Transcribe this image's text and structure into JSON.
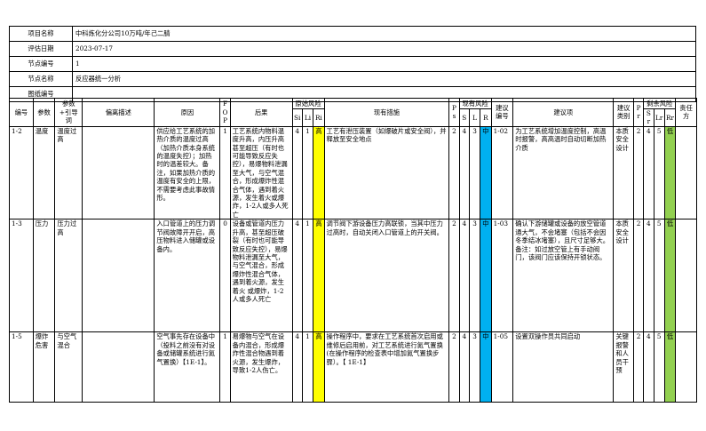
{
  "info": [
    {
      "label": "项目名称",
      "value": "中科炼化分公司10万吨/年己二腈"
    },
    {
      "label": "评估日期",
      "value": "2023-07-17"
    },
    {
      "label": "节点编号",
      "value": "1"
    },
    {
      "label": "节点名称",
      "value": "反应器统一分析"
    },
    {
      "label": "图纸编号",
      "value": ""
    }
  ],
  "headers": {
    "no": "编号",
    "param": "参数",
    "guideword": "参数+引导词",
    "deviation": "偏离描述",
    "cause": "原因",
    "fop": "FOP",
    "consequence": "后果",
    "orig_risk": "原始风险",
    "measures": "现有措施",
    "ps": "Ps",
    "cur_risk": "现有风险",
    "rec_no": "建议编号",
    "rec": "建议项",
    "rec_type": "建议类别",
    "pr": "Pr",
    "res_risk": "剩余风险",
    "owner": "责任方",
    "sub": {
      "si": "Si",
      "li": "Li",
      "ri": "Ri",
      "s": "S",
      "l": "L",
      "r": "R",
      "sr": "Sr",
      "lr": "Lr",
      "rr": "Rr"
    }
  },
  "rows": [
    {
      "no": "1-2",
      "param": "温度",
      "guideword": "温度过高",
      "deviation": "",
      "cause": "供应给工艺系统的加热介质的温度过高（加热介质本身系统的温度失控）；加热时的温差较大。备注，如果加热介质的温度有安全的上限，不需要考虑此事故情形。",
      "fop": "1",
      "consequence": "工艺系统内物料温度升高，内压升高甚至超压（有时也可能导致反应失控），易爆物料泄漏至大气，与空气混合，形成爆炸性混合气体，遇到着火源，发生着火或爆炸，1-2人或多人死亡",
      "si": "4",
      "li": "1",
      "ri": "高",
      "measures": "工艺有泄压装置（如爆破片或安全阀），并释放至安全地点",
      "ps": "2",
      "s": "4",
      "l": "3",
      "r": "中",
      "rec_no": "1-02",
      "rec": "为工艺系统增加温度控制，高温时报警，高高温时自动切断加热介质",
      "rec_type": "本质安全设计",
      "pr": "2",
      "sr": "4",
      "lr": "5",
      "rr": "低",
      "owner": ""
    },
    {
      "no": "1-3",
      "param": "压力",
      "guideword": "压力过高",
      "deviation": "",
      "cause": "入口管道上的压力调节阀故障开开启，高压物料进入储罐或设备内。",
      "fop": "0",
      "consequence": "设备或管道内压力升高，甚至超压破裂（有时也可能导致反应失控），易爆物料泄漏至大气，与空气混合，形成爆炸性混合气体，遇到着火源，发生着火 或爆炸，1-2人或多人死亡",
      "si": "4",
      "li": "1",
      "ri": "高",
      "measures": "调节阀下游设备压力高联锁，当其中压力过高时，自动关闭入口管道上的开关阀。",
      "ps": "2",
      "s": "4",
      "l": "3",
      "r": "中",
      "rec_no": "1-03",
      "rec": "确认下游储罐或设备的放空管道通大气，不会堵塞（包括不会因冬季结冰堵塞），且尺寸足够大。备注：如过放空管上有手动阀门，该阀门应该保持开锁状态。",
      "rec_type": "本质安全设计",
      "pr": "2",
      "sr": "4",
      "lr": "5",
      "rr": "低",
      "owner": ""
    },
    {
      "no": "1-5",
      "param": "爆炸危害",
      "guideword": "与空气混合",
      "deviation": "",
      "cause": "空气事先存在设备中（投料之前没有对设备或储罐系统进行氮气置换）【1E-1】。",
      "fop": "1",
      "consequence": "易爆物与空气在设备内混合，形成爆炸性混合物遇到着火源，发生爆炸，导致1-2人伤亡。",
      "si": "4",
      "li": "1",
      "ri": "高",
      "measures": "操作程序中，要求在工艺系统首次启用或维修后启用前，对工艺系统进行氮气置换(在操作程序的检查表中增加氮气置换步骤）。【 1E-1】",
      "ps": "2",
      "s": "4",
      "l": "3",
      "r": "中",
      "rec_no": "1-05",
      "rec": "设置双操作员共同启动",
      "rec_type": "关键报警和人员干预",
      "pr": "2",
      "sr": "4",
      "lr": "5",
      "rr": "低",
      "owner": ""
    }
  ]
}
